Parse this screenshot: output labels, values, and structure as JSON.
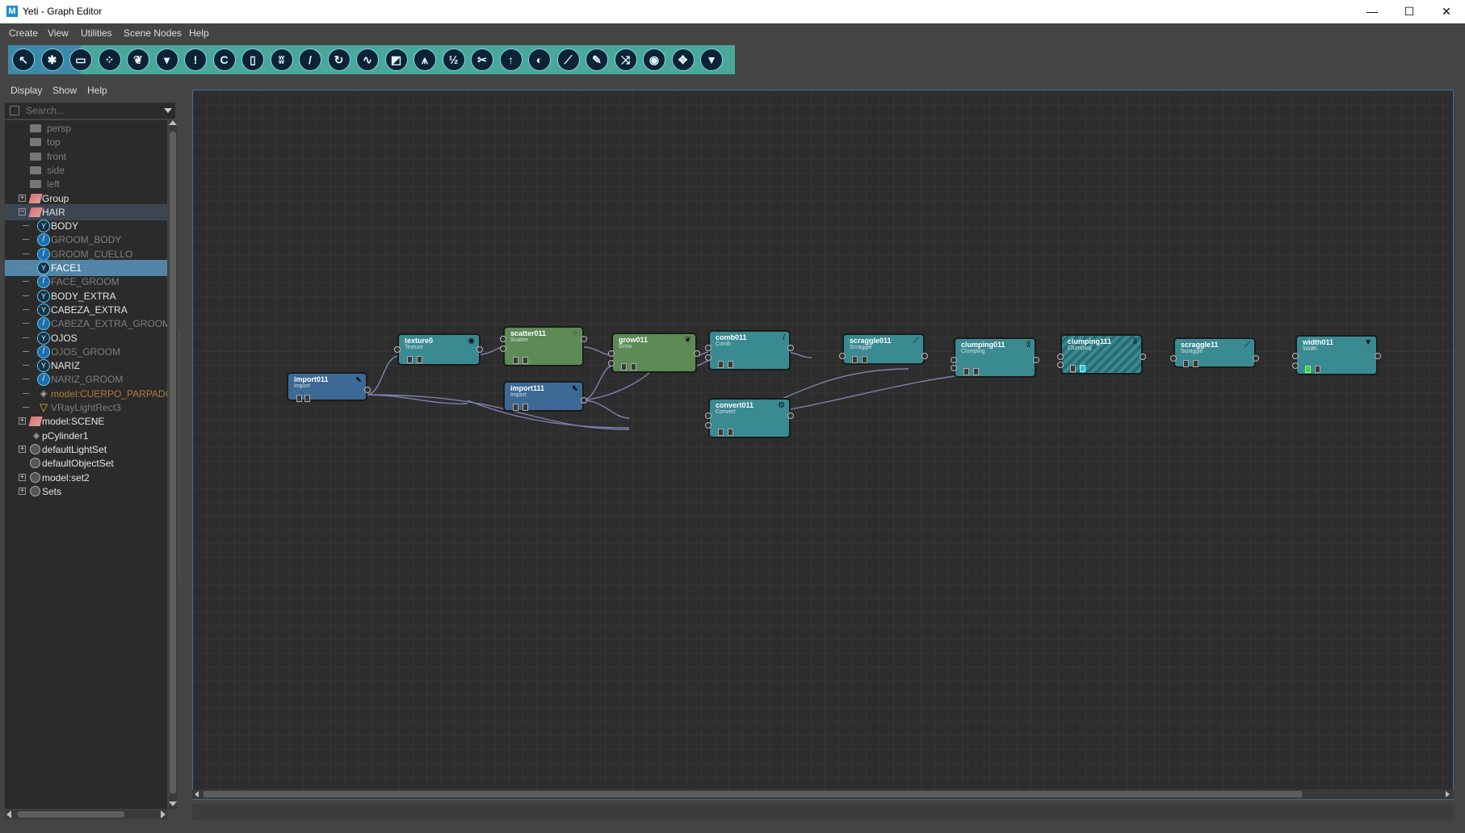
{
  "window": {
    "title": "Yeti - Graph Editor",
    "logo": "M"
  },
  "window_controls": {
    "minimize": "—",
    "maximize": "☐",
    "close": "✕"
  },
  "menubar": [
    "Create",
    "View",
    "Utilities",
    "Scene Nodes",
    "Help"
  ],
  "toolbar": {
    "tools": [
      {
        "icon": "select-arrow-icon",
        "glyph": "↖"
      },
      {
        "icon": "node-gear-icon",
        "glyph": "✱"
      },
      {
        "icon": "archive-box-icon",
        "glyph": "▭"
      },
      {
        "icon": "scatter-icon",
        "glyph": "⁘"
      },
      {
        "icon": "grow-leaf-icon",
        "glyph": "❦"
      },
      {
        "icon": "bucket-icon",
        "glyph": "▾"
      },
      {
        "icon": "attention-icon",
        "glyph": "!"
      },
      {
        "icon": "curl-icon",
        "glyph": "C"
      },
      {
        "icon": "battery-icon",
        "glyph": "▯"
      },
      {
        "icon": "clump-icon",
        "glyph": "ʬ"
      },
      {
        "icon": "comb-icon",
        "glyph": "/"
      },
      {
        "icon": "rotate-icon",
        "glyph": "↻"
      },
      {
        "icon": "wave-icon",
        "glyph": "∿"
      },
      {
        "icon": "brush-icon",
        "glyph": "◩"
      },
      {
        "icon": "noise-icon",
        "glyph": "⩚"
      },
      {
        "icon": "split-icon",
        "glyph": "½"
      },
      {
        "icon": "cut-icon",
        "glyph": "✂"
      },
      {
        "icon": "up-arrow-icon",
        "glyph": "↑"
      },
      {
        "icon": "moon-icon",
        "glyph": "◐"
      },
      {
        "icon": "scraggle-icon",
        "glyph": "⟋"
      },
      {
        "icon": "pen-icon",
        "glyph": "✎"
      },
      {
        "icon": "shuffle-icon",
        "glyph": "⤨"
      },
      {
        "icon": "palette-icon",
        "glyph": "◉"
      },
      {
        "icon": "move-icon",
        "glyph": "✥"
      },
      {
        "icon": "width-funnel-icon",
        "glyph": "▼"
      }
    ]
  },
  "outliner": {
    "menu": [
      "Display",
      "Show",
      "Help"
    ],
    "search_placeholder": "Search...",
    "items": [
      {
        "label": "persp",
        "type": "camera",
        "style": "dim",
        "level": 0,
        "expander": ""
      },
      {
        "label": "top",
        "type": "camera",
        "style": "dim",
        "level": 0,
        "expander": ""
      },
      {
        "label": "front",
        "type": "camera",
        "style": "dim",
        "level": 0,
        "expander": ""
      },
      {
        "label": "side",
        "type": "camera",
        "style": "dim",
        "level": 0,
        "expander": ""
      },
      {
        "label": "left",
        "type": "camera",
        "style": "dim",
        "level": 0,
        "expander": ""
      },
      {
        "label": "Group",
        "type": "group",
        "style": "bright",
        "level": 0,
        "expander": "+"
      },
      {
        "label": "HAIR",
        "type": "group",
        "style": "bright",
        "level": 0,
        "expander": "-",
        "highlight": true
      },
      {
        "label": "BODY",
        "type": "yeti",
        "style": "bright",
        "level": 1
      },
      {
        "label": "GROOM_BODY",
        "type": "groom",
        "style": "dim",
        "level": 1
      },
      {
        "label": "GROOM_CUELLO",
        "type": "groom",
        "style": "dim",
        "level": 1
      },
      {
        "label": "FACE1",
        "type": "yeti",
        "style": "bright",
        "level": 1,
        "selected": true
      },
      {
        "label": "FACE_GROOM",
        "type": "groom",
        "style": "dim",
        "level": 1
      },
      {
        "label": "BODY_EXTRA",
        "type": "yeti",
        "style": "bright",
        "level": 1
      },
      {
        "label": "CABEZA_EXTRA",
        "type": "yeti",
        "style": "bright",
        "level": 1
      },
      {
        "label": "CABEZA_EXTRA_GROOM",
        "type": "groom",
        "style": "dim",
        "level": 1
      },
      {
        "label": "OJOS",
        "type": "yeti",
        "style": "bright",
        "level": 1
      },
      {
        "label": "OJOS_GROOM",
        "type": "groom",
        "style": "dim",
        "level": 1
      },
      {
        "label": "NARIZ",
        "type": "yeti",
        "style": "bright",
        "level": 1
      },
      {
        "label": "NARIZ_GROOM",
        "type": "groom",
        "style": "dim",
        "level": 1
      },
      {
        "label": "model:CUERPO_PARPADO",
        "type": "mesh",
        "style": "orange",
        "level": 1
      },
      {
        "label": "VRayLightRect3",
        "type": "light",
        "style": "dim",
        "level": 1
      },
      {
        "label": "model:SCENE",
        "type": "group",
        "style": "bright",
        "level": 0,
        "expander": "+"
      },
      {
        "label": "pCylinder1",
        "type": "mesh",
        "style": "bright",
        "level": 0,
        "expander": ""
      },
      {
        "label": "defaultLightSet",
        "type": "set",
        "style": "bright",
        "level": 0,
        "expander": "+"
      },
      {
        "label": "defaultObjectSet",
        "type": "set",
        "style": "bright",
        "level": 0,
        "expander": ""
      },
      {
        "label": "model:set2",
        "type": "set",
        "style": "bright",
        "level": 0,
        "expander": "+"
      },
      {
        "label": "Sets",
        "type": "set",
        "style": "bright",
        "level": 0,
        "expander": "+"
      }
    ]
  },
  "graph": {
    "nodes": [
      {
        "id": "import011",
        "title": "import011",
        "subtitle": "Import",
        "color": "blue",
        "icon": "import-arrow-icon",
        "glyph": "⬉"
      },
      {
        "id": "texture0",
        "title": "texture0",
        "subtitle": "Texture",
        "color": "teal",
        "icon": "texture-eye-icon",
        "glyph": "◉"
      },
      {
        "id": "scatter011",
        "title": "scatter011",
        "subtitle": "Scatter",
        "color": "green",
        "icon": "scatter-icon",
        "glyph": "⁘"
      },
      {
        "id": "import111",
        "title": "import111",
        "subtitle": "Import",
        "color": "blue",
        "icon": "import-arrow-icon",
        "glyph": "⬉"
      },
      {
        "id": "grow011",
        "title": "grow011",
        "subtitle": "Grow",
        "color": "green",
        "icon": "grow-leaf-icon",
        "glyph": "❦"
      },
      {
        "id": "comb011",
        "title": "comb011",
        "subtitle": "Comb",
        "color": "teal",
        "icon": "comb-icon",
        "glyph": "/"
      },
      {
        "id": "convert011",
        "title": "convert011",
        "subtitle": "Convert",
        "color": "teal",
        "icon": "convert-icon",
        "glyph": "⚙"
      },
      {
        "id": "scraggle011",
        "title": "scraggle011",
        "subtitle": "Scraggle",
        "color": "teal",
        "icon": "scraggle-icon",
        "glyph": "⟋"
      },
      {
        "id": "clumping011",
        "title": "clumping011",
        "subtitle": "Clumping",
        "color": "teal",
        "icon": "clump-icon",
        "glyph": "ʬ"
      },
      {
        "id": "clumping111",
        "title": "clumping111",
        "subtitle": "Clumping",
        "color": "hatched",
        "icon": "clump-icon",
        "glyph": "ʬ"
      },
      {
        "id": "scraggle11",
        "title": "scraggle11",
        "subtitle": "Scraggle",
        "color": "teal",
        "icon": "scraggle-icon",
        "glyph": "⟋"
      },
      {
        "id": "width011",
        "title": "width011",
        "subtitle": "Width",
        "color": "teal",
        "icon": "width-funnel-icon",
        "glyph": "▼"
      }
    ]
  }
}
